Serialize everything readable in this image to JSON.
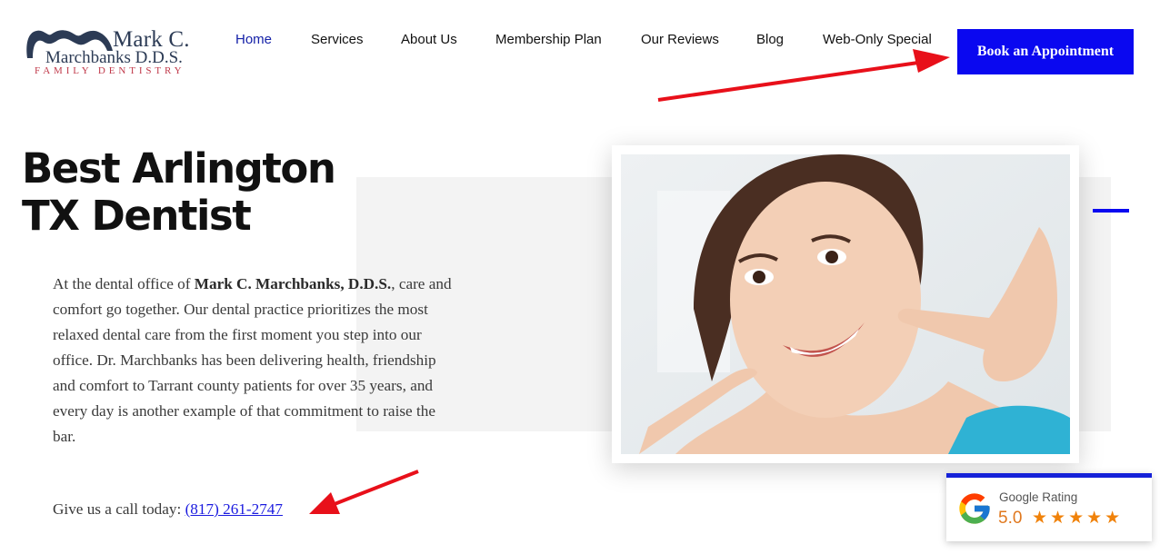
{
  "logo": {
    "line1": "Mark C.",
    "line2": "Marchbanks D.D.S.",
    "line3": "FAMILY DENTISTRY"
  },
  "nav": {
    "items": [
      {
        "label": "Home"
      },
      {
        "label": "Services"
      },
      {
        "label": "About Us"
      },
      {
        "label": "Membership Plan"
      },
      {
        "label": "Our Reviews"
      },
      {
        "label": "Blog"
      },
      {
        "label": "Web-Only Special"
      }
    ],
    "cta_label": "Book an Appointment"
  },
  "hero": {
    "title": "Best Arlington TX Dentist",
    "body_pre": "At the dental office of ",
    "body_bold": "Mark C. Marchbanks, D.D.S.",
    "body_post": ", care and comfort go together. Our dental practice prioritizes the most relaxed dental care from the first moment you step into our office. Dr. Marchbanks has been delivering health, friendship and comfort to Tarrant county patients for over 35 years, and every day is another example of that commitment to raise the bar.",
    "call_prefix": "Give us a call today: ",
    "phone": "(817) 261-2747"
  },
  "google_rating": {
    "title": "Google Rating",
    "score": "5.0",
    "stars": "★★★★★"
  },
  "colors": {
    "accent_blue": "#0a08f0",
    "nav_active": "#1521a8",
    "annotation_arrow": "#e8101a",
    "star": "#f0820a"
  },
  "icons": [
    "tooth-logo-icon",
    "google-g-icon",
    "star-icon",
    "arrow-annotation-icon"
  ]
}
